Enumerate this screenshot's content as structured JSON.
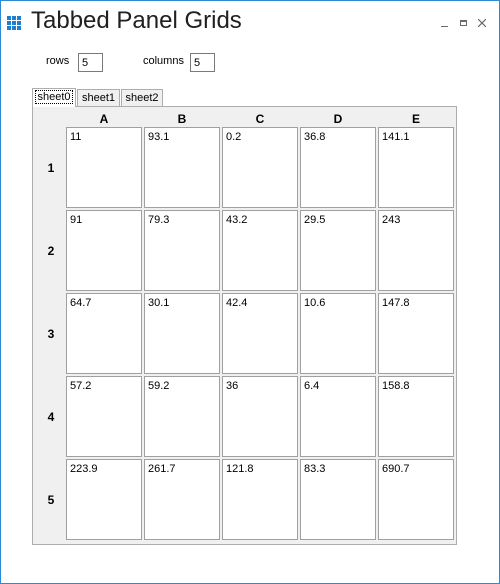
{
  "window": {
    "title": "Tabbed Panel Grids"
  },
  "controls": {
    "rows_label": "rows",
    "rows_value": "5",
    "columns_label": "columns",
    "columns_value": "5"
  },
  "tabs": [
    {
      "label": "sheet0",
      "active": true
    },
    {
      "label": "sheet1",
      "active": false
    },
    {
      "label": "sheet2",
      "active": false
    }
  ],
  "grid": {
    "columns": [
      "A",
      "B",
      "C",
      "D",
      "E"
    ],
    "rows": [
      "1",
      "2",
      "3",
      "4",
      "5"
    ],
    "cells": [
      [
        "11",
        "93.1",
        "0.2",
        "36.8",
        "141.1"
      ],
      [
        "91",
        "79.3",
        "43.2",
        "29.5",
        "243"
      ],
      [
        "64.7",
        "30.1",
        "42.4",
        "10.6",
        "147.8"
      ],
      [
        "57.2",
        "59.2",
        "36",
        "6.4",
        "158.8"
      ],
      [
        "223.9",
        "261.7",
        "121.8",
        "83.3",
        "690.7"
      ]
    ]
  },
  "colors": {
    "accent": "#1e7fd0",
    "border": "#2b8ad6"
  }
}
